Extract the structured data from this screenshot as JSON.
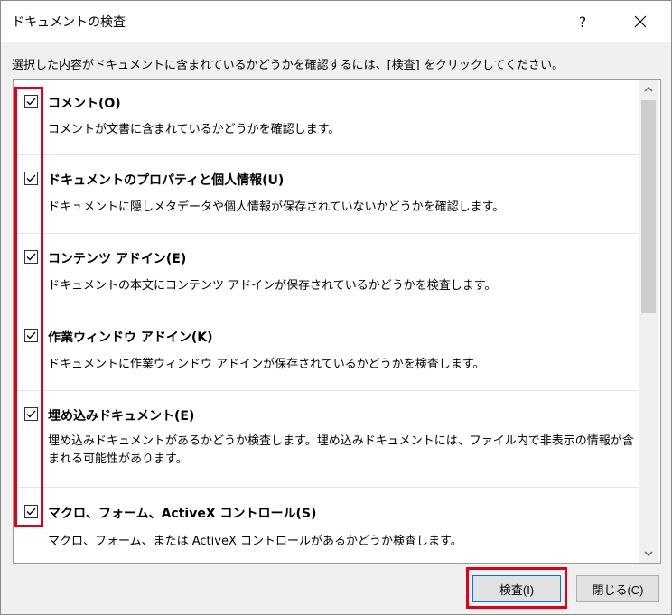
{
  "window": {
    "title": "ドキュメントの検査",
    "help_label": "?",
    "close_icon": "close-icon"
  },
  "instruction": "選択した内容がドキュメントに含まれているかどうかを確認するには、[検査] をクリックしてください。",
  "items": [
    {
      "title": "コメント(O)",
      "desc": "コメントが文書に含まれているかどうかを確認します。",
      "checked": true
    },
    {
      "title": "ドキュメントのプロパティと個人情報(U)",
      "desc": "ドキュメントに隠しメタデータや個人情報が保存されていないかどうかを確認します。",
      "checked": true
    },
    {
      "title": "コンテンツ アドイン(E)",
      "desc": "ドキュメントの本文にコンテンツ アドインが保存されているかどうかを検査します。",
      "checked": true
    },
    {
      "title": "作業ウィンドウ アドイン(K)",
      "desc": "ドキュメントに作業ウィンドウ アドインが保存されているかどうかを検査します。",
      "checked": true
    },
    {
      "title": "埋め込みドキュメント(E)",
      "desc": "埋め込みドキュメントがあるかどうか検査します。埋め込みドキュメントには、ファイル内で非表示の情報が含まれる可能性があります。",
      "checked": true
    },
    {
      "title": "マクロ、フォーム、ActiveX コントロール(S)",
      "desc": "マクロ、フォーム、または ActiveX コントロールがあるかどうか検査します。",
      "checked": true
    }
  ],
  "buttons": {
    "inspect": "検査(I)",
    "close": "閉じる(C)"
  },
  "colors": {
    "highlight": "#e0001b",
    "focus_border": "#0078d7"
  }
}
